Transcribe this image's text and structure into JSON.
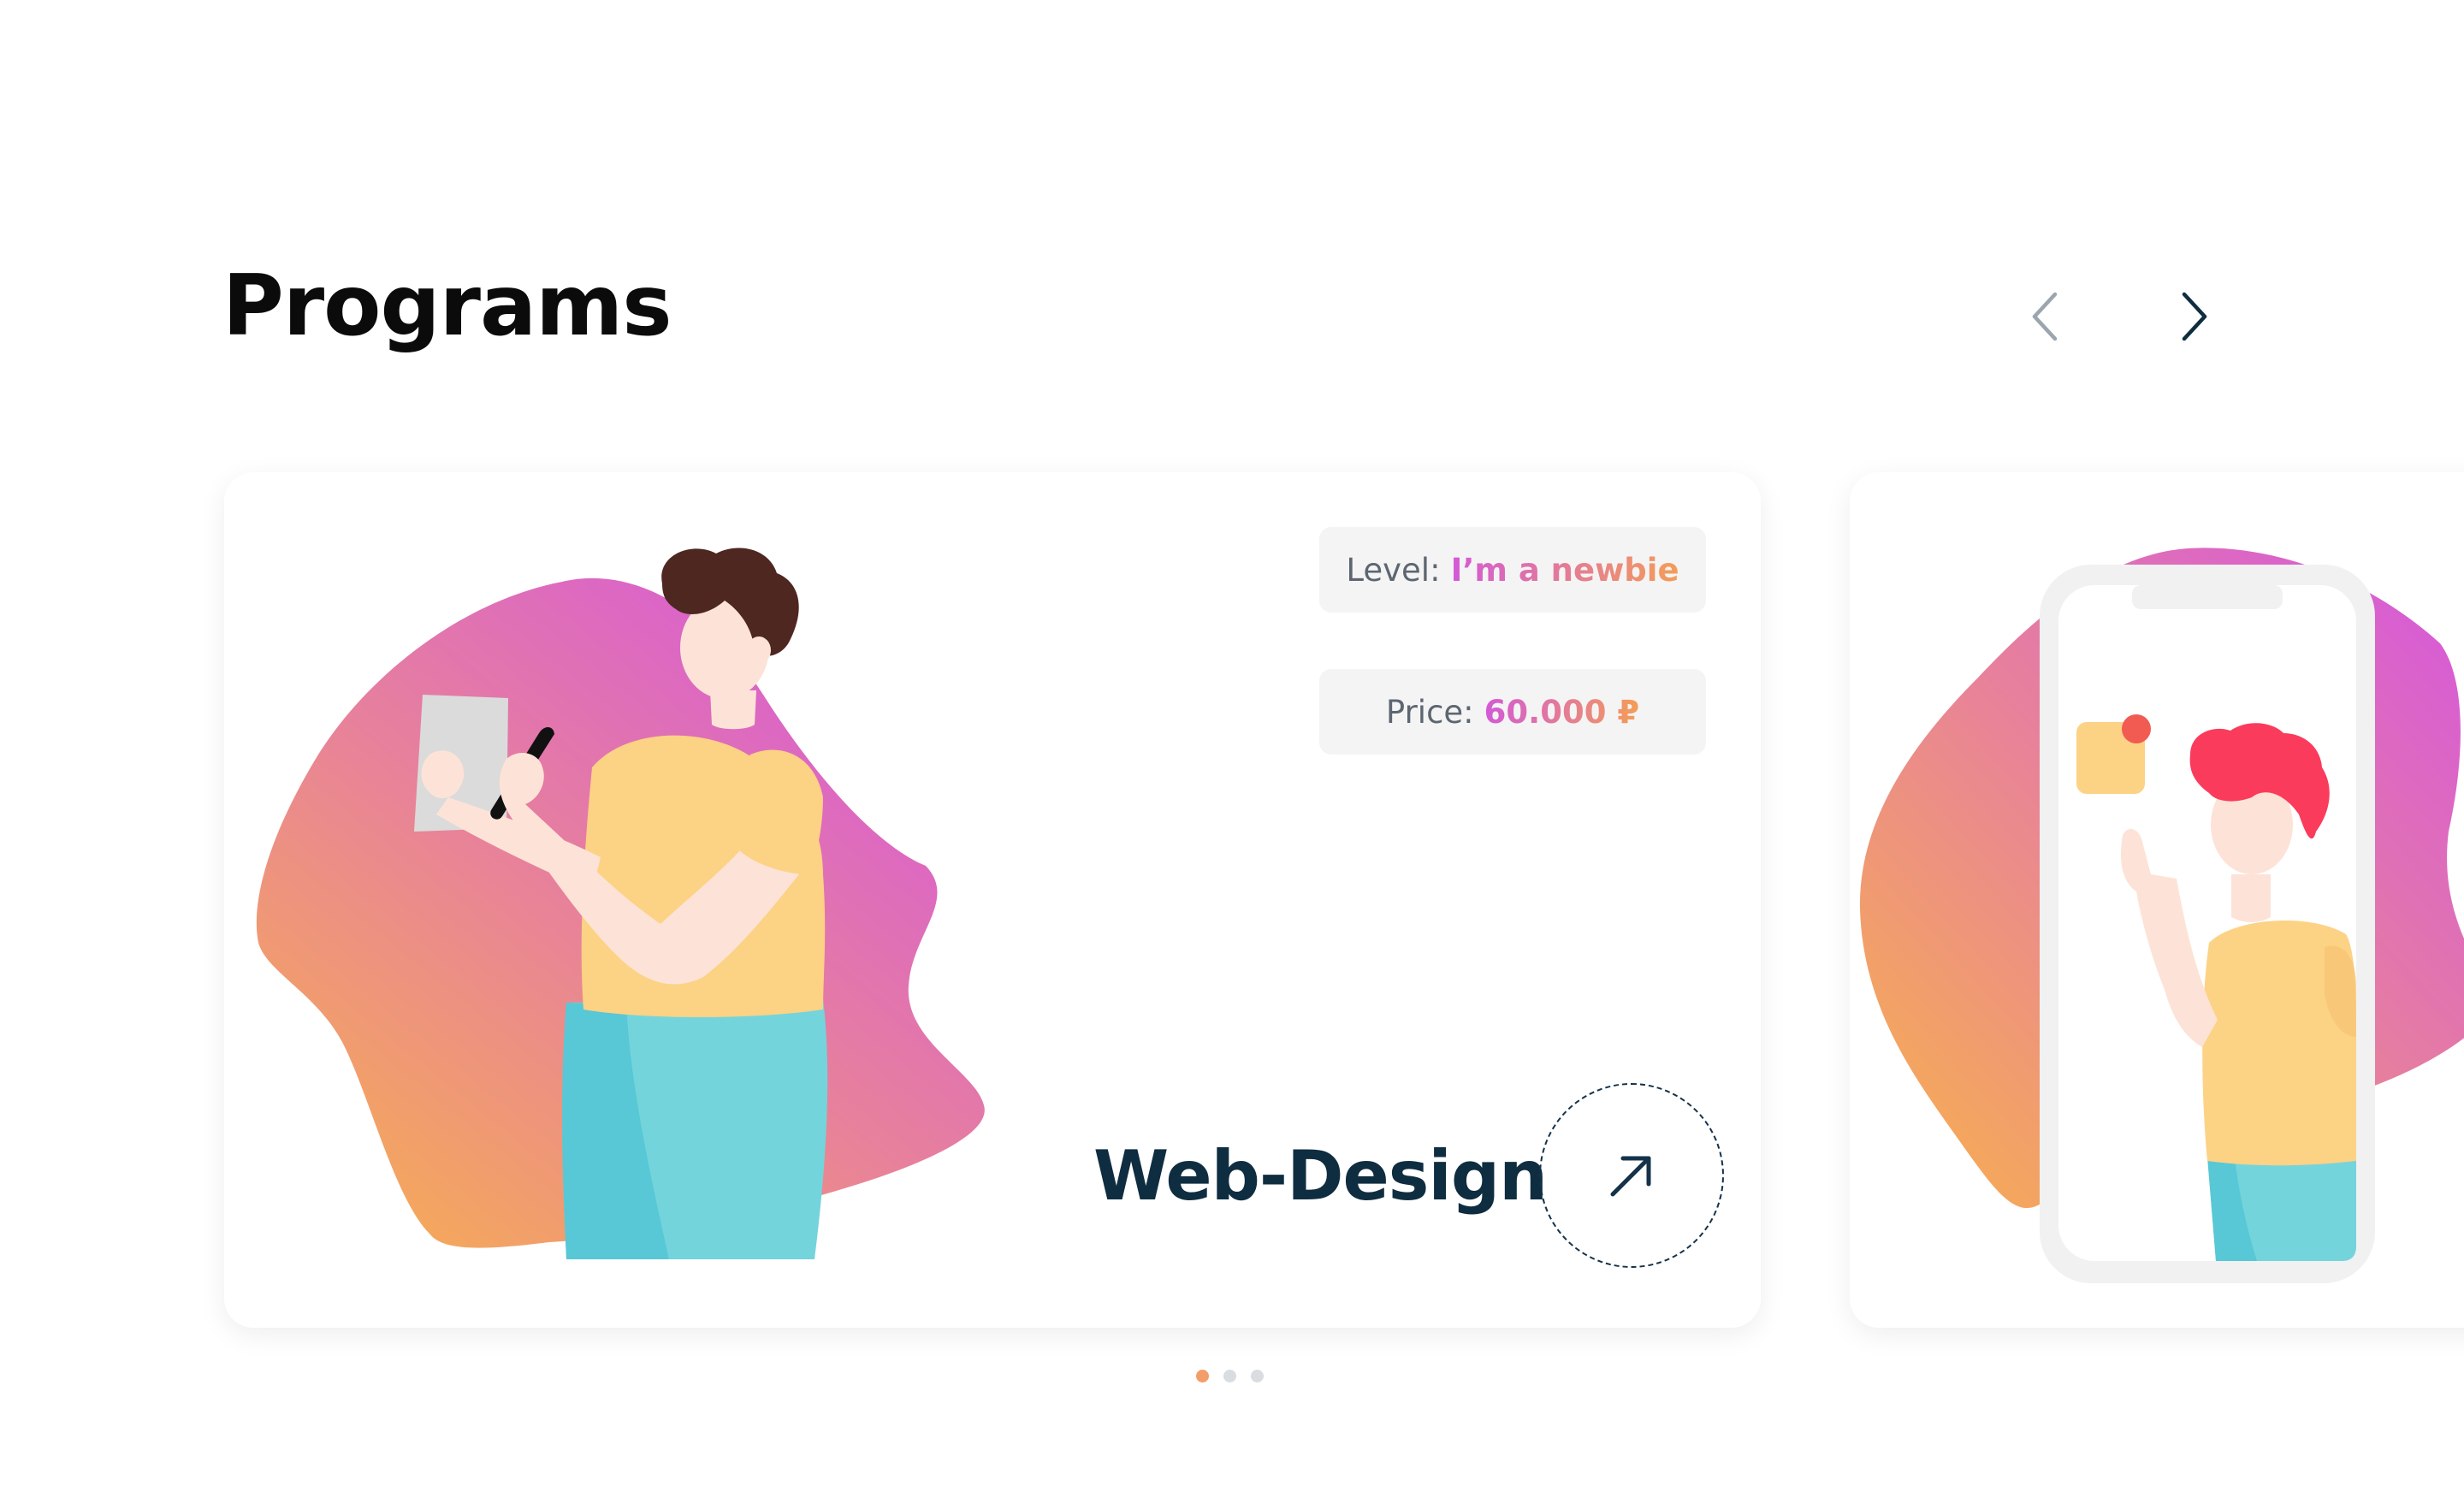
{
  "section": {
    "title": "Programs"
  },
  "navigation": {
    "prev_icon": "chevron-left-icon",
    "next_icon": "chevron-right-icon"
  },
  "cards": [
    {
      "level_label": "Level:",
      "level_value": "I’m a newbie",
      "price_label": "Price:",
      "price_value": "60.000 ₽",
      "title": "Web-Design",
      "open_icon": "arrow-up-right-icon"
    },
    {
      "title": ""
    }
  ],
  "pagination": {
    "total": 3,
    "active_index": 0
  },
  "colors": {
    "title_text": "#0b0b0b",
    "course_title": "#0f2d40",
    "accent_gradient_start": "#d35ad6",
    "accent_gradient_end": "#f49d57",
    "nav_active": "#0f2d40",
    "nav_inactive": "#9aa5af",
    "pill_background": "#f4f4f5",
    "dot_active": "#f39d6a",
    "dot_inactive": "#d9dce0"
  }
}
